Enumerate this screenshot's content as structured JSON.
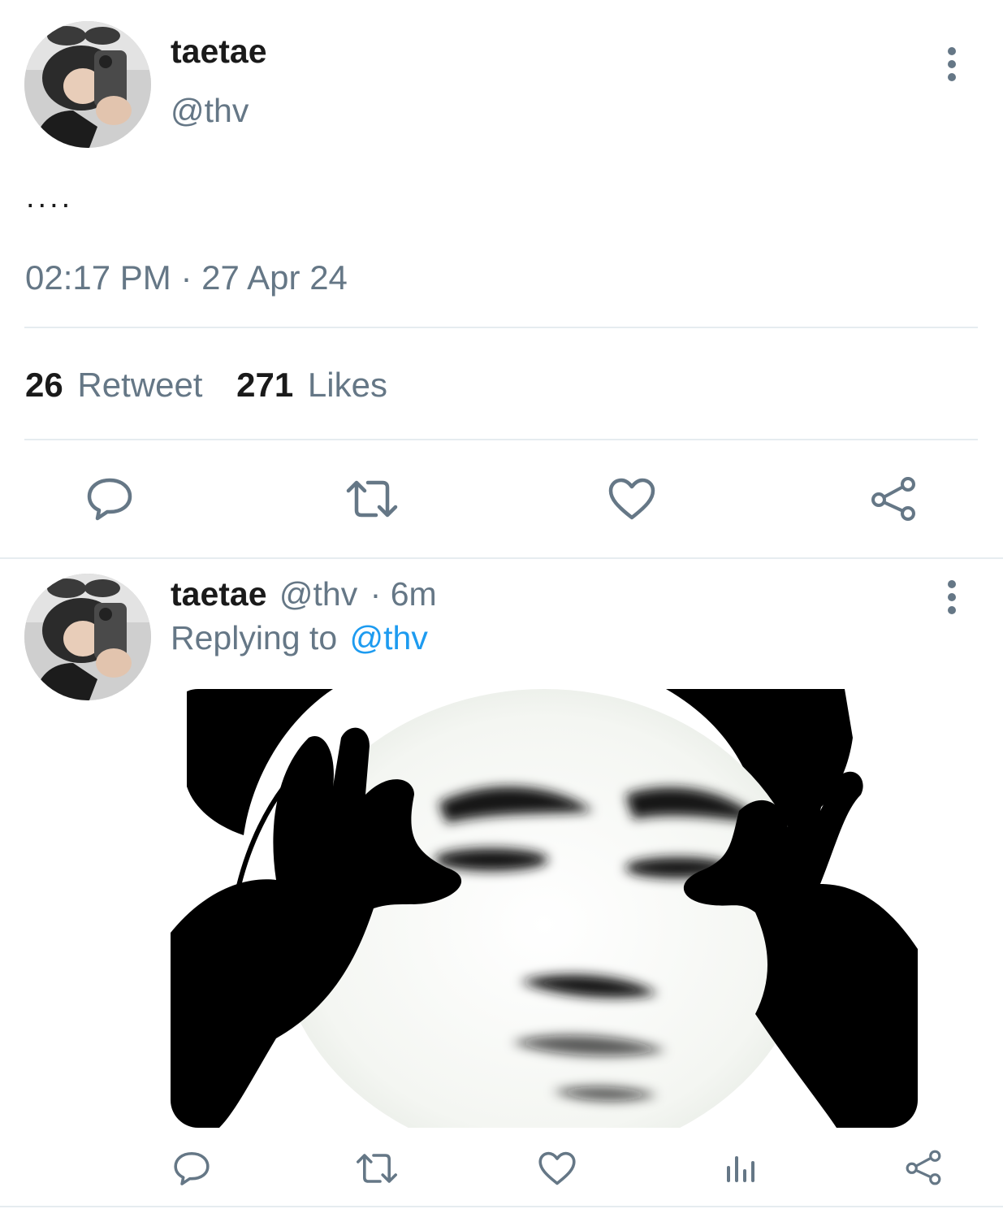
{
  "main_tweet": {
    "display_name": "taetae",
    "handle": "@thv",
    "text": "....",
    "timestamp": "02:17 PM · 27 Apr 24",
    "stats": {
      "retweet_count": "26",
      "retweet_label": "Retweet",
      "like_count": "271",
      "like_label": "Likes"
    },
    "actions": [
      "reply-icon",
      "retweet-icon",
      "like-icon",
      "share-icon"
    ]
  },
  "reply_tweet": {
    "display_name": "taetae",
    "handle": "@thv",
    "time_ago": "· 6m",
    "replying_to_label": "Replying to",
    "replying_to_handle": "@thv",
    "actions": [
      "reply-icon",
      "retweet-icon",
      "like-icon",
      "analytics-icon",
      "share-icon"
    ]
  },
  "colors": {
    "accent": "#1d9bf0",
    "muted_text": "#657786",
    "divider": "#e6ecf0",
    "icon": "#657786"
  }
}
